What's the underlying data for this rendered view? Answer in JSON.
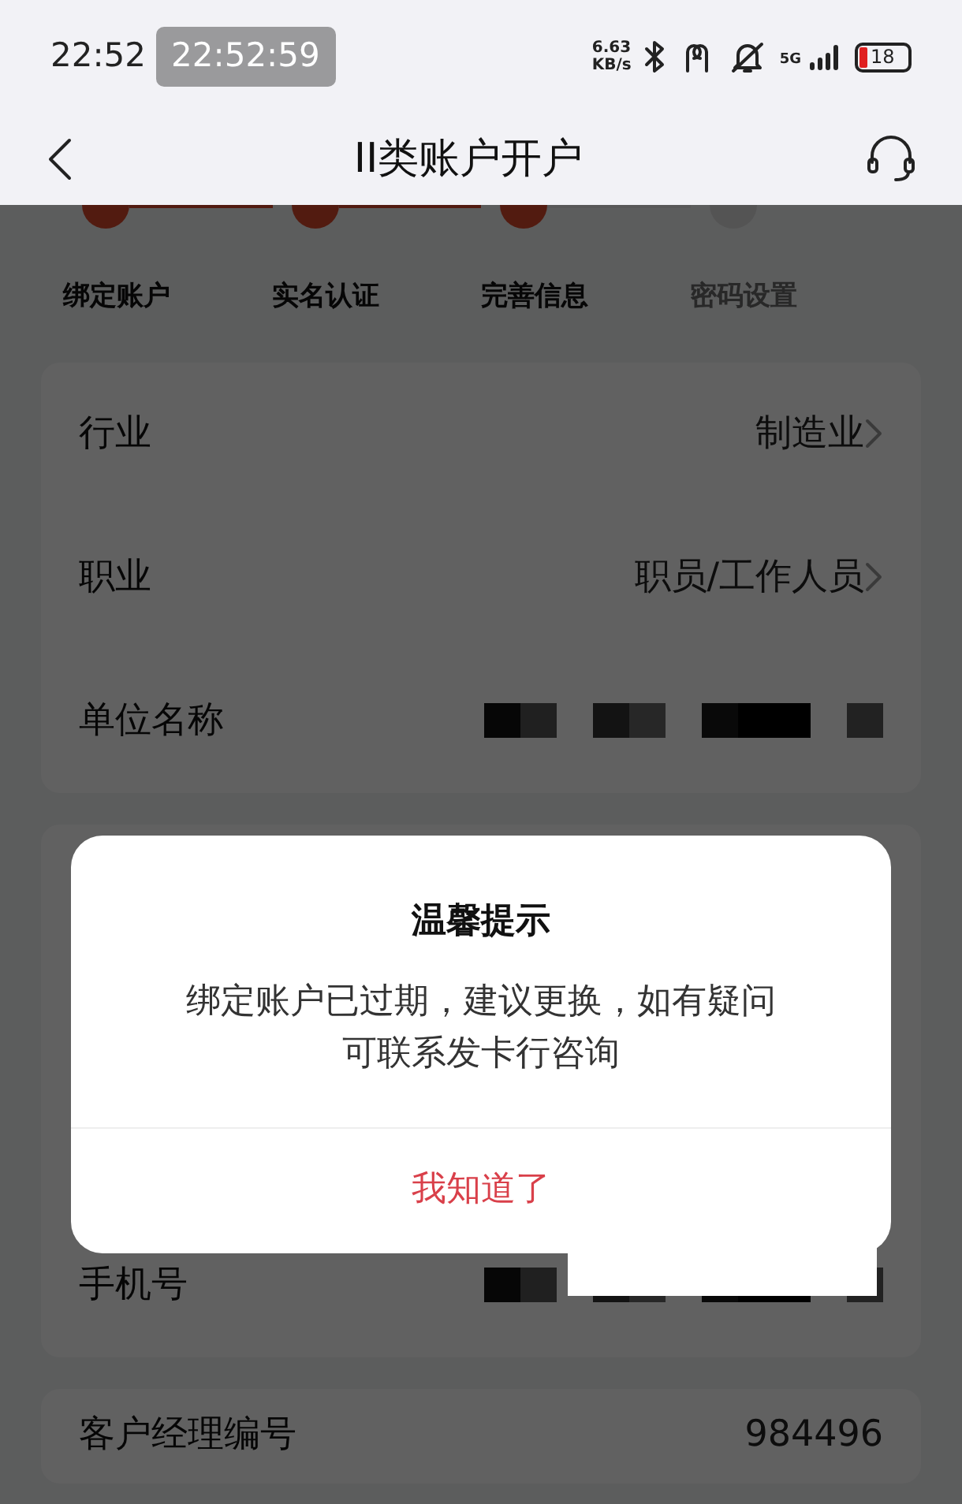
{
  "status_bar": {
    "time": "22:52",
    "clock_overlay": "22:52:59",
    "speed_value": "6.63",
    "speed_unit": "KB/s",
    "network": "5G",
    "battery": "18"
  },
  "nav": {
    "title": "II类账户开户"
  },
  "steps": [
    {
      "label": "绑定账户",
      "done": true
    },
    {
      "label": "实名认证",
      "done": true
    },
    {
      "label": "完善信息",
      "done": true
    },
    {
      "label": "密码设置",
      "done": false
    }
  ],
  "form_sections": [
    {
      "rows": [
        {
          "kind": "select",
          "label": "行业",
          "value": "制造业"
        },
        {
          "kind": "select",
          "label": "职业",
          "value": "职员/工作人员"
        },
        {
          "kind": "redacted",
          "label": "单位名称"
        }
      ]
    },
    {
      "rows": [
        {
          "kind": "redacted",
          "label": "手机号"
        }
      ]
    },
    {
      "rows": [
        {
          "kind": "text",
          "label": "客户经理编号",
          "value": "984496"
        }
      ]
    }
  ],
  "dialog": {
    "title": "温馨提示",
    "message": "绑定账户已过期，建议更换，如有疑问可联系发卡行咨询",
    "button": "我知道了"
  }
}
